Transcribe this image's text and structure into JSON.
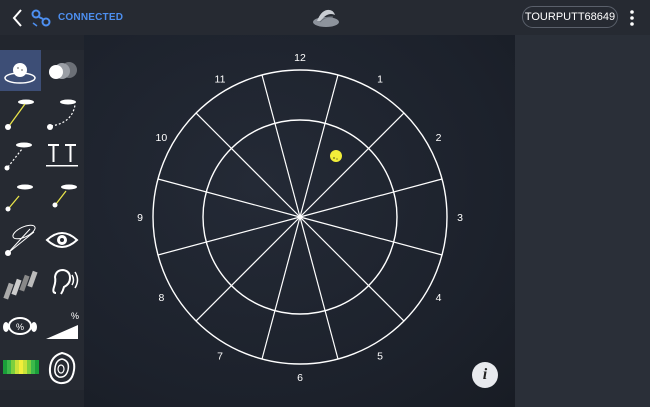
{
  "header": {
    "connection_status": "CONNECTED",
    "device_name": "TOURPUTT68649"
  },
  "icons": {
    "back": "chevron-left-icon",
    "connection": "link-chain-icon",
    "logo": "brand-logo-icon",
    "more": "more-vertical-icon",
    "info": "info-icon"
  },
  "toolbar": {
    "tools": [
      {
        "name": "ball-on-green-tool",
        "active": true
      },
      {
        "name": "ball-trail-tool",
        "active": false
      },
      {
        "name": "straight-putt-line-tool",
        "active": false
      },
      {
        "name": "curved-putt-line-tool",
        "active": false
      },
      {
        "name": "putt-from-distance-tool",
        "active": false
      },
      {
        "name": "t-markers-tool",
        "active": false
      },
      {
        "name": "short-putt-tool",
        "active": false
      },
      {
        "name": "angled-putt-tool",
        "active": false
      },
      {
        "name": "putt-lines-with-ellipse-tool",
        "active": false
      },
      {
        "name": "eye-view-tool",
        "active": false
      },
      {
        "name": "stripes-tool",
        "active": false
      },
      {
        "name": "hearing-tool",
        "active": false
      },
      {
        "name": "percent-footprints-tool",
        "active": false
      },
      {
        "name": "slope-percent-tool",
        "active": false
      },
      {
        "name": "color-bar-tool",
        "active": false
      },
      {
        "name": "green-contour-tool",
        "active": false
      }
    ],
    "slope_label": "%"
  },
  "target": {
    "clock_labels": [
      "12",
      "1",
      "2",
      "3",
      "4",
      "5",
      "6",
      "7",
      "8",
      "9",
      "10",
      "11"
    ],
    "ball": {
      "sector": "between 12 and 1, inner ring",
      "color": "#f2ee3a"
    }
  },
  "info_button": {
    "label": "i"
  },
  "colors": {
    "accent": "#4d8ff0",
    "active_tool": "#3d4e76",
    "ball": "#f2ee3a"
  }
}
